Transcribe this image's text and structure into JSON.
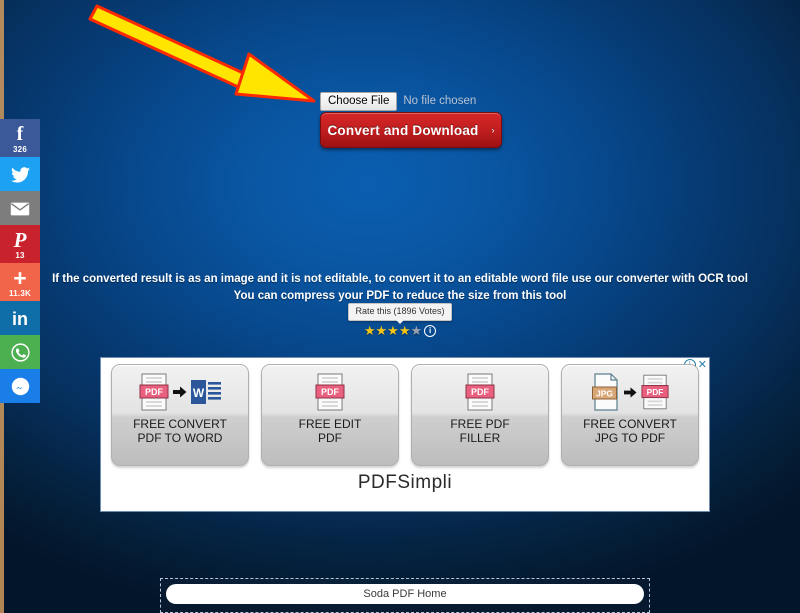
{
  "page": {
    "background_top_color": "#0a5eb0",
    "background_edge_color": "#03152a"
  },
  "social_rail": {
    "items": [
      {
        "name": "facebook",
        "glyph": "f",
        "count": "326",
        "color": "#3b5998"
      },
      {
        "name": "twitter",
        "glyph": "t",
        "count": "",
        "color": "#1da1f2"
      },
      {
        "name": "email",
        "glyph": "m",
        "count": "",
        "color": "#7d7d7d"
      },
      {
        "name": "pinterest",
        "glyph": "p",
        "count": "13",
        "color": "#c8232c"
      },
      {
        "name": "share-more",
        "glyph": "+",
        "count": "11.3K",
        "color": "#f1664b"
      },
      {
        "name": "linkedin",
        "glyph": "in",
        "count": "",
        "color": "#0f6ea8"
      },
      {
        "name": "whatsapp",
        "glyph": "w",
        "count": "",
        "color": "#4caf50"
      },
      {
        "name": "messenger",
        "glyph": "M",
        "count": "",
        "color": "#1a7ee8"
      }
    ]
  },
  "uploader": {
    "choose_file_label": "Choose File",
    "no_file_text": "No file chosen",
    "convert_label": "Convert and Download",
    "convert_chevron": "›"
  },
  "info": {
    "line1": "If the converted result is as an image and it is not editable, to convert it to an editable word file use our converter with OCR tool",
    "line2": "You can compress your PDF to reduce the size from this tool"
  },
  "rating": {
    "tooltip": "Rate this (1896 Votes)",
    "stars_filled": 4,
    "stars_total": 5,
    "star_glyph": "★",
    "info_glyph": "i",
    "filled_color": "#f5c518",
    "empty_color": "#9aa3ad"
  },
  "ad": {
    "brand": "PDFSimpli",
    "adchoices_glyph": "ⓘ",
    "close_glyph": "✕",
    "cards": [
      {
        "label_line1": "FREE CONVERT",
        "label_line2": "PDF TO WORD",
        "icon": "pdf-to-word-icon"
      },
      {
        "label_line1": "FREE EDIT",
        "label_line2": "PDF",
        "icon": "pdf-edit-icon"
      },
      {
        "label_line1": "FREE PDF",
        "label_line2": "FILLER",
        "icon": "pdf-filler-icon"
      },
      {
        "label_line1": "FREE CONVERT",
        "label_line2": "JPG TO PDF",
        "icon": "jpg-to-pdf-icon"
      }
    ]
  },
  "footer": {
    "soda_label": "Soda PDF Home"
  },
  "annotation": {
    "arrow_fill": "#ffe500",
    "arrow_stroke": "#ff2a00",
    "points_to": "choose-file-button"
  }
}
